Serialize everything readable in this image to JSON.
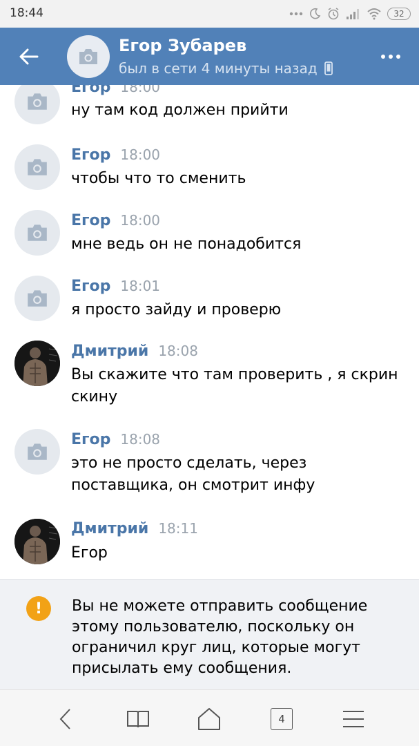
{
  "status_bar": {
    "time": "18:44",
    "battery": "32"
  },
  "header": {
    "name": "Егор Зубарев",
    "status": "был в сети 4 минуты назад"
  },
  "messages": [
    {
      "author": "Егор",
      "time": "18:00",
      "text": "ну там код должен прийти",
      "avatar": "camera-placeholder"
    },
    {
      "author": "Егор",
      "time": "18:00",
      "text": "чтобы что то сменить",
      "avatar": "camera-placeholder"
    },
    {
      "author": "Егор",
      "time": "18:00",
      "text": "мне ведь он не понадобится",
      "avatar": "camera-placeholder"
    },
    {
      "author": "Егор",
      "time": "18:01",
      "text": "я просто зайду и проверю",
      "avatar": "camera-placeholder"
    },
    {
      "author": "Дмитрий",
      "time": "18:08",
      "text": "Вы скажите что там проверить , я скрин скину",
      "avatar": "user-photo"
    },
    {
      "author": "Егор",
      "time": "18:08",
      "text": "это не просто сделать, через поставщика, он смотрит инфу",
      "avatar": "camera-placeholder"
    },
    {
      "author": "Дмитрий",
      "time": "18:11",
      "text": "Егор",
      "avatar": "user-photo"
    }
  ],
  "notice": {
    "text": "Вы не можете отправить сообщение этому пользователю, поскольку он ограничил круг лиц, которые могут присылать ему сообщения.",
    "icon": "warning-icon"
  },
  "nav": {
    "tabs_count": "4"
  },
  "colors": {
    "header": "#5181b8",
    "author": "#4a76a8",
    "warning": "#f2a216"
  }
}
